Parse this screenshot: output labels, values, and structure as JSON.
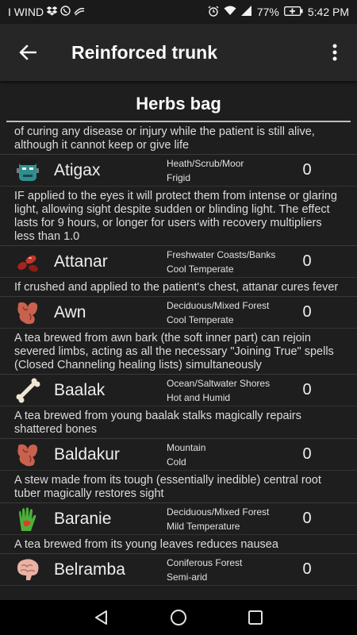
{
  "status_bar": {
    "carrier": "I WIND",
    "battery": "77%",
    "time": "5:42 PM"
  },
  "app_bar": {
    "title": "Reinforced trunk"
  },
  "section": {
    "title": "Herbs bag"
  },
  "top_description": "of curing any disease or injury while the patient is still alive, although it cannot keep or give life",
  "herbs": [
    {
      "name": "Atigax",
      "icon": "zombie-face-icon",
      "habitat": "Heath/Scrub/Moor",
      "climate": "Frigid",
      "count": "0",
      "description": "IF applied to the eyes it will protect them from intense or glaring light, allowing sight despite sudden or blinding light. The effect lasts for 9 hours, or longer for users with recovery multipliers less than 1.0"
    },
    {
      "name": "Attanar",
      "icon": "pills-icon",
      "habitat": "Freshwater Coasts/Banks",
      "climate": "Cool Temperate",
      "count": "0",
      "description": "If crushed and applied to the patient's chest, attanar cures fever"
    },
    {
      "name": "Awn",
      "icon": "organs-icon",
      "habitat": "Deciduous/Mixed Forest",
      "climate": "Cool Temperate",
      "count": "0",
      "description": "A tea brewed from awn bark (the soft inner part) can rejoin severed limbs, acting as all the necessary \"Joining True\" spells (Closed Channeling healing lists) simultaneously"
    },
    {
      "name": "Baalak",
      "icon": "bone-icon",
      "habitat": "Ocean/Saltwater Shores",
      "climate": "Hot and Humid",
      "count": "0",
      "description": "A tea brewed from young baalak stalks magically repairs shattered bones"
    },
    {
      "name": "Baldakur",
      "icon": "organs-icon",
      "habitat": "Mountain",
      "climate": "Cold",
      "count": "0",
      "description": "A stew made from its tough (essentially inedible) central root tuber magically restores sight"
    },
    {
      "name": "Baranie",
      "icon": "hand-icon",
      "habitat": "Deciduous/Mixed Forest",
      "climate": "Mild Temperature",
      "count": "0",
      "description": "A tea brewed from its young leaves reduces nausea"
    },
    {
      "name": "Belramba",
      "icon": "brain-icon",
      "habitat": "Coniferous Forest",
      "climate": "Semi-arid",
      "count": "0",
      "description": ""
    }
  ],
  "colors": {
    "background": "#1e1e1e",
    "app_bar": "#262626",
    "nav_bar": "#000000",
    "text": "#e6e6e6"
  }
}
